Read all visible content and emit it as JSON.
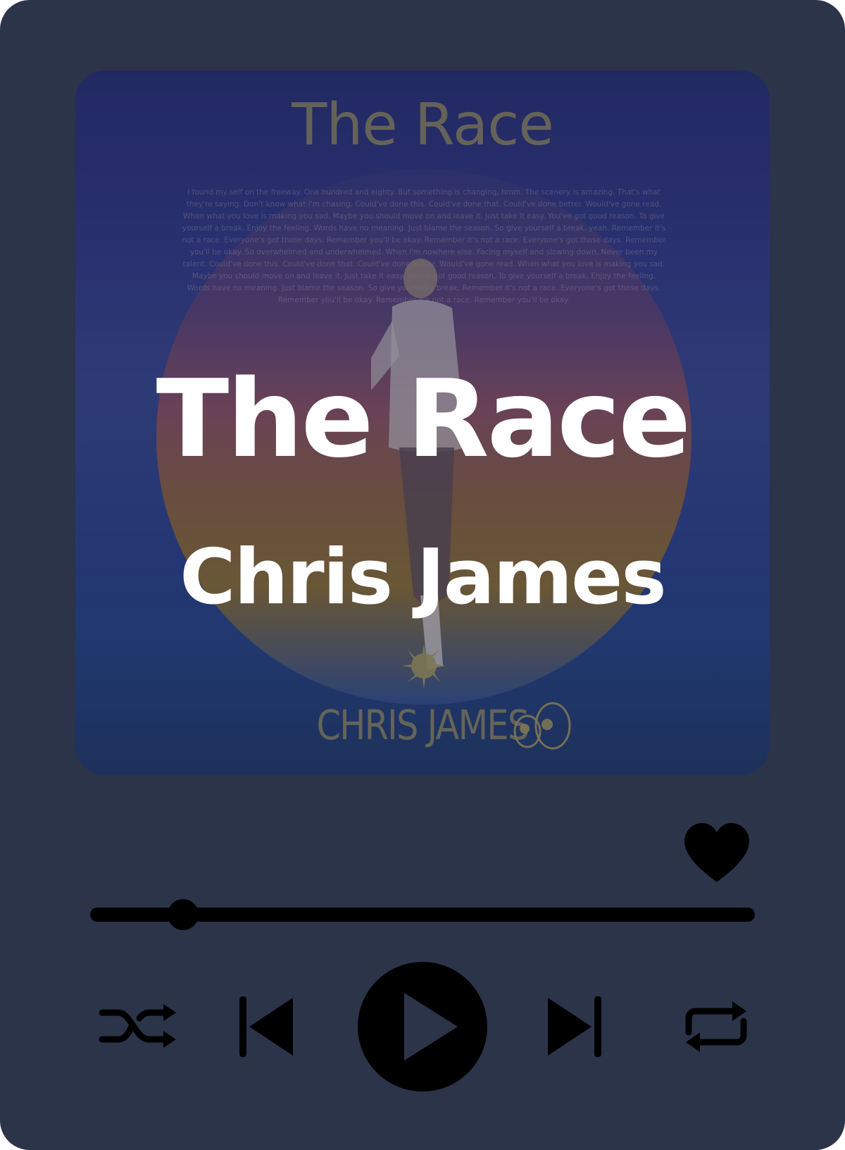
{
  "player": {
    "song_title": "The Race",
    "artist": "Chris James",
    "progress_fraction": 0.14,
    "liked": true
  },
  "cover_art": {
    "title": "The Race",
    "artist": "CHRIS JAMES",
    "lyrics": "I found my self on the freeway. One hundred and eighty. But something is changing, hmm. The scenery is amazing. That's what they're saying. Don't know what I'm chasing. Could've done this. Could've done that. Could've done better. Would've gone read. When what you love is making you sad. Maybe you should move on and leave it. Just take it easy. You've got good reason. To give yourself a break. Enjoy the feeling. Words have no meaning. Just blame the season. So give yourself a break, yeah. Remember it's not a race. Everyone's got those days. Remember you'll be okay. Remember it's not a race. Everyone's got those days. Remember you'll be okay. So overwhelmed and underwhelmed. When I'm nowhere else. Facing myself and slowing down. Never been my talent. Could've done this. Could've done that. Could've done better. Would've gone read. When what you love is making you sad. Maybe you should move on and leave it. Just take it easy. You've got good reason. To give yourself a break. Enjoy the feeling. Words have no meaning. Just blame the season. So give yourself a break. Remember it's not a race. Everyone's got those days. Remember you'll be okay. Remember it's not a race. Remember you'll be okay."
  },
  "controls": {
    "shuffle_icon": "shuffle-icon",
    "previous_icon": "skip-previous-icon",
    "play_icon": "play-icon",
    "next_icon": "skip-next-icon",
    "repeat_icon": "repeat-icon",
    "like_icon": "heart-icon"
  },
  "colors": {
    "card_background": "#2b3449",
    "controls": "#000000",
    "title_text": "#ffffff"
  }
}
